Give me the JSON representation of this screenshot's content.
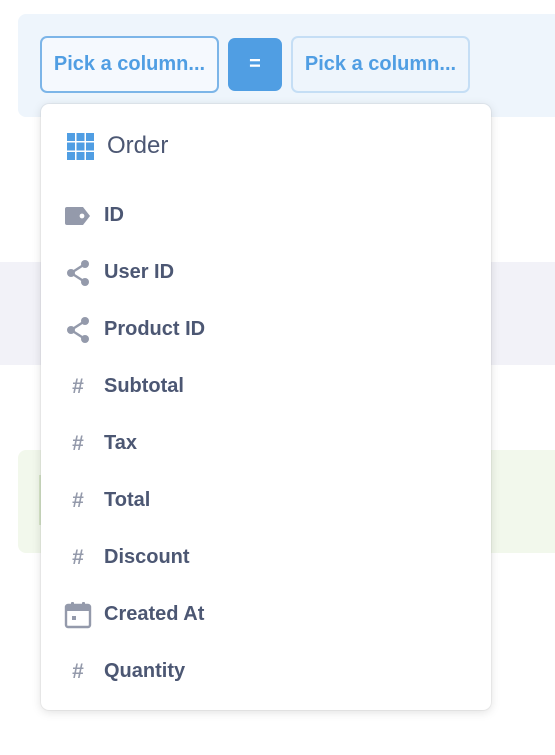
{
  "join": {
    "left_column_picker": "Pick a column...",
    "operator": "=",
    "right_column_picker": "Pick a column..."
  },
  "popover": {
    "table_name": "Order",
    "table_icon": "grid-icon",
    "columns": [
      {
        "label": "ID",
        "icon": "tag-icon"
      },
      {
        "label": "User ID",
        "icon": "connections-icon"
      },
      {
        "label": "Product ID",
        "icon": "connections-icon"
      },
      {
        "label": "Subtotal",
        "icon": "hash-icon"
      },
      {
        "label": "Tax",
        "icon": "hash-icon"
      },
      {
        "label": "Total",
        "icon": "hash-icon"
      },
      {
        "label": "Discount",
        "icon": "hash-icon"
      },
      {
        "label": "Created At",
        "icon": "calendar-icon"
      },
      {
        "label": "Quantity",
        "icon": "hash-icon"
      }
    ]
  },
  "colors": {
    "brand": "#509ee3",
    "text_dark": "#4c5773",
    "icon_gray": "#949aab",
    "join_panel_bg": "#eef5fc",
    "filter_band_bg": "#f2f2f8",
    "summarize_panel_bg": "#f2f8ec"
  }
}
